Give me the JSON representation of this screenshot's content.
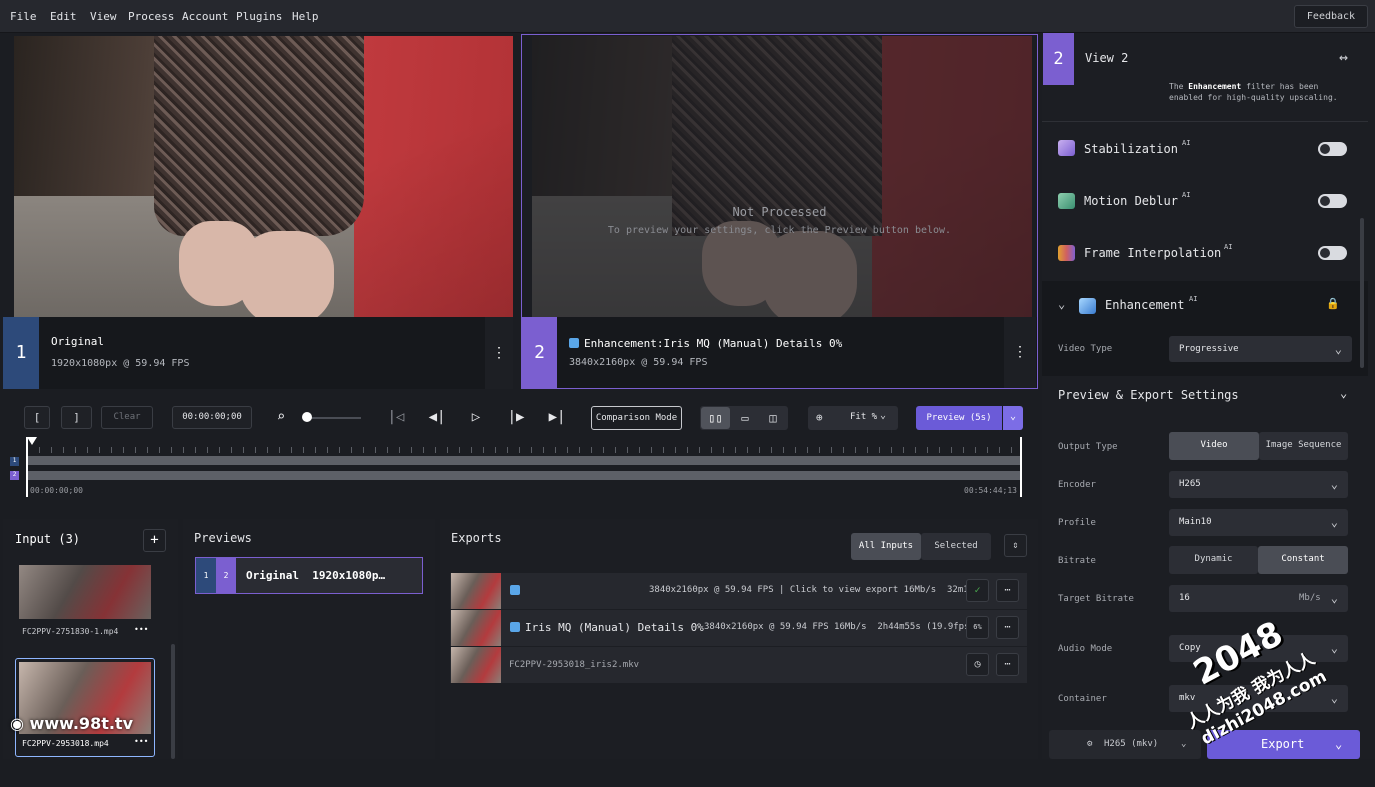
{
  "menu": {
    "file": "File",
    "edit": "Edit",
    "view": "View",
    "process": "Process",
    "account": "Account",
    "plugins": "Plugins",
    "help": "Help",
    "feedback": "Feedback"
  },
  "viewer1": {
    "num": "1",
    "title": "Original",
    "details": "1920x1080px @ 59.94 FPS"
  },
  "viewer2": {
    "num": "2",
    "title": "Enhancement:Iris MQ (Manual) Details 0%",
    "details": "3840x2160px @ 59.94 FPS",
    "not_processed": "Not Processed",
    "hint": "To preview your settings, click the Preview button below."
  },
  "controls": {
    "mark_in": "[",
    "mark_out": "]",
    "clear": "Clear",
    "timecode": "00:00:00;00",
    "comparison": "Comparison Mode",
    "zoom": "Fit %",
    "preview": "Preview (5s)"
  },
  "timeline": {
    "start": "00:00:00;00",
    "end": "00:54:44;13",
    "track1": "1",
    "track2": "2"
  },
  "input": {
    "title": "Input (3)",
    "add": "+",
    "files": [
      "FC2PPV-2751830-1.mp4",
      "FC2PPV-2953018.mp4"
    ],
    "more": "•••"
  },
  "previews": {
    "title": "Previews",
    "item_n1": "1",
    "item_n2": "2",
    "item_label": "Original  1920x1080p…"
  },
  "exports": {
    "title": "Exports",
    "all": "All Inputs",
    "selected": "Selected",
    "rows": [
      {
        "name": "",
        "info": "3840x2160px @ 59.94 FPS | Click to view export 16Mb/s  32m17s",
        "status": "✓"
      },
      {
        "name": "Iris MQ (Manual) Details 0%",
        "info": "3840x2160px @ 59.94 FPS 16Mb/s  2h44m55s (19.9fps)",
        "status": "6%"
      },
      {
        "name": "FC2PPV-2953018_iris2.mkv",
        "info": "",
        "status": "◷"
      }
    ]
  },
  "right": {
    "view_num": "2",
    "view_title": "View 2",
    "view_expand": "↔",
    "note": "The Enhancement filter has been enabled for high-quality upscaling.",
    "note_bold": "Enhancement",
    "filters": [
      "Stabilization",
      "Motion Deblur",
      "Frame Interpolation"
    ],
    "ai": "AI",
    "enhancement": "Enhancement",
    "video_type_label": "Video Type",
    "video_type": "Progressive",
    "pes": "Preview & Export Settings",
    "output_type_label": "Output Type",
    "video": "Video",
    "image_seq": "Image Sequence",
    "encoder_label": "Encoder",
    "encoder": "H265",
    "profile_label": "Profile",
    "profile": "Main10",
    "bitrate_label": "Bitrate",
    "dynamic": "Dynamic",
    "constant": "Constant",
    "target_label": "Target Bitrate",
    "target": "16",
    "unit": "Mb/s",
    "audio_label": "Audio Mode",
    "audio": "Copy",
    "container_label": "Container",
    "container": "mkv",
    "format_btn": "H265 (mkv)",
    "export": "Export"
  },
  "watermarks": {
    "site": "www.98t.tv",
    "num": "2048",
    "cn": "人人为我 我为人人",
    "url": "dizhi2048.com"
  },
  "colors": {
    "accent": "#6b5bd8",
    "view1": "#2d4a7a",
    "view2": "#7b5fd0",
    "ok": "#4caf50"
  }
}
